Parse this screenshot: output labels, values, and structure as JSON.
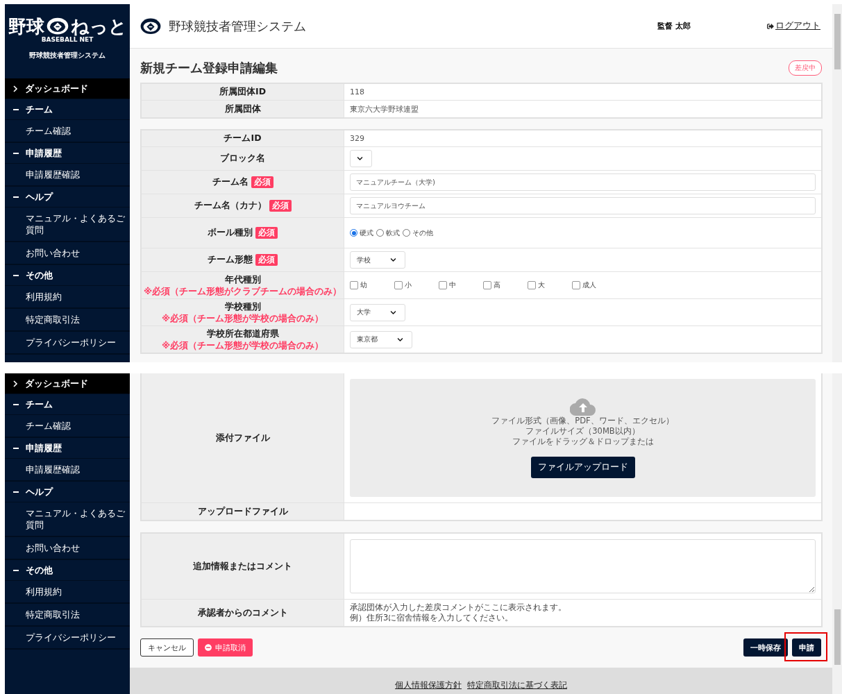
{
  "sidebar": {
    "logo": {
      "left": "野球",
      "right": "ねっと",
      "subtitle": "BASEBALL NET"
    },
    "system_name": "野球競技者管理システム",
    "items": [
      {
        "label": "ダッシュボード",
        "expanded": false,
        "selected": true
      },
      {
        "label": "チーム",
        "expanded": true,
        "selected": false,
        "children": [
          {
            "label": "チーム確認",
            "selected": false
          }
        ]
      },
      {
        "label": "申請履歴",
        "expanded": true,
        "selected": false,
        "children": [
          {
            "label": "申請履歴確認",
            "selected": false
          }
        ]
      },
      {
        "label": "ヘルプ",
        "expanded": true,
        "selected": false,
        "children": [
          {
            "label": "マニュアル・よくあるご質問",
            "selected": false
          },
          {
            "label": "お問い合わせ",
            "selected": false
          }
        ]
      },
      {
        "label": "その他",
        "expanded": true,
        "selected": false,
        "children": [
          {
            "label": "利用規約",
            "selected": false
          },
          {
            "label": "特定商取引法",
            "selected": false
          },
          {
            "label": "プライバシーポリシー",
            "selected": false
          }
        ]
      }
    ]
  },
  "header": {
    "title": "野球競技者管理システム",
    "user": "監督 太郎",
    "logout": "ログアウト"
  },
  "page": {
    "title": "新規チーム登録申請編集",
    "status": "差戻中"
  },
  "org_table": [
    {
      "label": "所属団体ID",
      "value": "118"
    },
    {
      "label": "所属団体",
      "value": "東京六大学野球連盟"
    }
  ],
  "team_table": [
    {
      "label": "チームID",
      "kind": "text",
      "value": "329"
    },
    {
      "label": "ブロック名",
      "kind": "select"
    },
    {
      "label": "チーム名",
      "badge": "必須",
      "kind": "input",
      "value": "マニュアルチーム（大学)"
    },
    {
      "label": "チーム名（カナ）",
      "badge": "必須",
      "kind": "input",
      "value": "マニュアルヨウチーム"
    },
    {
      "label": "ボール種別",
      "badge": "必須",
      "kind": "radio",
      "options": [
        {
          "label": "硬式",
          "selected": true
        },
        {
          "label": "軟式",
          "selected": false
        },
        {
          "label": "その他",
          "selected": false
        }
      ]
    },
    {
      "label": "チーム形態",
      "badge": "必須",
      "kind": "select",
      "value": "学校"
    },
    {
      "label": "年代種別",
      "note": "※必須（チーム形態がクラブチームの場合のみ）",
      "kind": "checkbox",
      "options": [
        {
          "label": "幼",
          "checked": false
        },
        {
          "label": "小",
          "checked": false
        },
        {
          "label": "中",
          "checked": false
        },
        {
          "label": "高",
          "checked": false
        },
        {
          "label": "大",
          "checked": false
        },
        {
          "label": "成人",
          "checked": false
        }
      ]
    },
    {
      "label": "学校種別",
      "note": "※必須（チーム形態が学校の場合のみ）",
      "kind": "select",
      "value": "大学"
    },
    {
      "label": "学校所在都道府県",
      "note": "※必須（チーム形態が学校の場合のみ）",
      "kind": "select",
      "value": "東京都"
    }
  ],
  "lower_view": {
    "sidebar_items": [
      {
        "label": "ダッシュボード",
        "expanded": false,
        "selected": true
      },
      {
        "label": "チーム",
        "expanded": true,
        "selected": false,
        "children": [
          {
            "label": "チーム確認",
            "selected": false
          }
        ]
      },
      {
        "label": "申請履歴",
        "expanded": true,
        "selected": false,
        "children": [
          {
            "label": "申請履歴確認",
            "selected": false
          }
        ]
      },
      {
        "label": "ヘルプ",
        "expanded": true,
        "selected": false,
        "children": [
          {
            "label": "マニュアル・よくあるご質問",
            "selected": false
          },
          {
            "label": "お問い合わせ",
            "selected": false
          }
        ]
      },
      {
        "label": "その他",
        "expanded": true,
        "selected": false,
        "children": [
          {
            "label": "利用規約",
            "selected": false
          },
          {
            "label": "特定商取引法",
            "selected": false
          },
          {
            "label": "プライバシーポリシー",
            "selected": false
          }
        ]
      }
    ],
    "attachment_table": [
      {
        "label": "添付ファイル",
        "kind": "dropzone",
        "lines": [
          "ファイル形式（画像、PDF、ワード、エクセル）",
          "ファイルサイズ（30MB以内）",
          "ファイルをドラッグ＆ドロップまたは"
        ],
        "button": "ファイルアップロード"
      },
      {
        "label": "アップロードファイル",
        "kind": "empty"
      }
    ],
    "comment_table": [
      {
        "label": "追加情報またはコメント",
        "kind": "textarea"
      },
      {
        "label": "承認者からのコメント",
        "kind": "text",
        "lines": [
          "承認団体が入力した差戻コメントがここに表示されます。",
          "例）住所3に宿舎情報を入力してください。"
        ]
      }
    ],
    "actions_left": [
      {
        "label": "キャンセル",
        "kind": "outline"
      },
      {
        "label": "申請取消",
        "kind": "danger"
      }
    ],
    "actions_right": [
      {
        "label": "一時保存",
        "kind": "primary",
        "highlighted": false
      },
      {
        "label": "申請",
        "kind": "primary",
        "highlighted": true
      }
    ],
    "footer_links": [
      "個人情報保護方針",
      "特定商取引法に基づく表記"
    ]
  }
}
